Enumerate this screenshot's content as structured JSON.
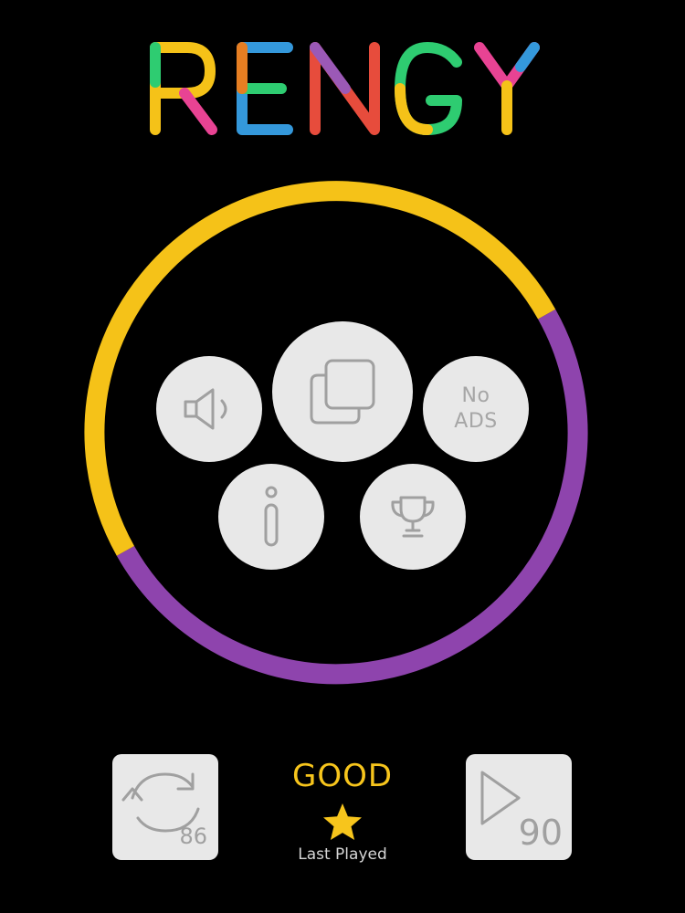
{
  "logo": {
    "text": "RENGY"
  },
  "ring": {
    "color_top": "#f5c218",
    "color_bottom": "#8e44ad"
  },
  "menu": {
    "sound_icon": "speaker-icon",
    "play_icon": "stacked-squares-icon",
    "no_ads_line1": "No",
    "no_ads_line2": "ADS",
    "info_icon": "info-icon",
    "trophy_icon": "trophy-icon"
  },
  "footer": {
    "restart_icon": "refresh-icon",
    "restart_count": "86",
    "rating": "GOOD",
    "rating_star_icon": "star-icon",
    "last_played_label": "Last Played",
    "next_icon": "play-triangle-icon",
    "level_number": "90"
  },
  "colors": {
    "background": "#000000",
    "button_fill": "#e8e8e8",
    "icon_gray": "#a0a0a0",
    "accent_yellow": "#f7c51c",
    "accent_purple": "#8e44ad"
  }
}
